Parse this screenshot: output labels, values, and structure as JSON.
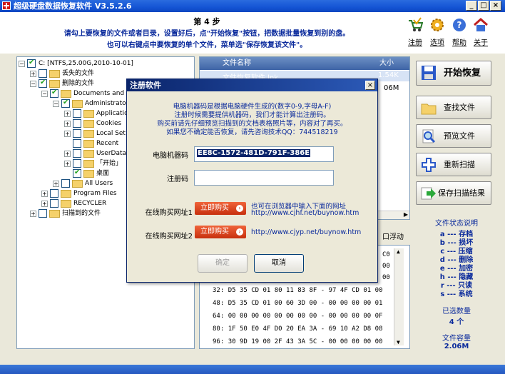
{
  "window": {
    "title": "超级硬盘数据恢复软件 V3.5.2.6",
    "min": "_",
    "max": "□",
    "close": "×"
  },
  "header": {
    "step": "第 4 步",
    "line1": "请勾上要恢复的文件或者目录，设置好后，点\"开始恢复\"按钮，把数据批量恢复到别的盘。",
    "line2": "也可以右键点中要恢复的单个文件，菜单选\"保存恢复该文件\"。"
  },
  "top_links": [
    {
      "label": "注册",
      "icon": "cart-icon"
    },
    {
      "label": "选项",
      "icon": "gear-icon"
    },
    {
      "label": "帮助",
      "icon": "help-icon"
    },
    {
      "label": "关于",
      "icon": "home-icon"
    }
  ],
  "tree": [
    {
      "text": "C: [NTFS,25.00G,2010-10-01]",
      "expander": "−",
      "checked": true
    },
    {
      "text": "丢失的文件",
      "expander": "+",
      "checked": false
    },
    {
      "text": "删除的文件",
      "expander": "−",
      "checked": true
    },
    {
      "text": "Documents and S",
      "expander": "−",
      "checked": true
    },
    {
      "text": "Administrator",
      "expander": "−",
      "checked": true
    },
    {
      "text": "Applicatio",
      "expander": "+",
      "checked": false
    },
    {
      "text": "Cookies",
      "expander": "+",
      "checked": false
    },
    {
      "text": "Local Set",
      "expander": "+",
      "checked": false
    },
    {
      "text": "Recent",
      "expander": "",
      "checked": false
    },
    {
      "text": "UserData",
      "expander": "+",
      "checked": false
    },
    {
      "text": "「开始」",
      "expander": "+",
      "checked": false
    },
    {
      "text": "桌面",
      "expander": "",
      "checked": true
    },
    {
      "text": "All Users",
      "expander": "+",
      "checked": false
    },
    {
      "text": "Program Files",
      "expander": "+",
      "checked": false
    },
    {
      "text": "RECYCLER",
      "expander": "+",
      "checked": false
    },
    {
      "text": "扫描到的文件",
      "expander": "+",
      "checked": false
    }
  ],
  "file_list": {
    "col_name": "文件名称",
    "col_size": "大小",
    "rows": [
      {
        "name": "文件恢复软件.lnk",
        "size": "1.54K"
      }
    ],
    "size2": "06M",
    "float_label": "口浮动"
  },
  "hex": {
    "rows": [
      {
        "off": "32:",
        "bytes": "D5 35 CD 01 80 11 83 8F - 97 4F CD 01 00"
      },
      {
        "off": "48:",
        "bytes": "D5 35 CD 01 00 60 3D 00 - 00 00 00 00 01"
      },
      {
        "off": "64:",
        "bytes": "00 00 00 00 00 00 00 00 - 00 00 00 00 0F"
      },
      {
        "off": "80:",
        "bytes": "1F 50 E0 4F D0 20 EA 3A - 69 10 A2 D8 08"
      },
      {
        "off": "96:",
        "bytes": "30 9D 19 00 2F 43 3A 5C - 00 00 00 00 00"
      }
    ],
    "side": [
      "C0",
      "00",
      "00"
    ]
  },
  "actions": [
    {
      "label": "开始恢复",
      "icon": "save-disk-icon"
    },
    {
      "label": "查找文件",
      "icon": "folder-icon"
    },
    {
      "label": "预览文件",
      "icon": "magnifier-icon"
    },
    {
      "label": "重新扫描",
      "icon": "plus-icon"
    },
    {
      "label": "保存扫描结果",
      "icon": "arrow-right-icon"
    }
  ],
  "legend": {
    "title": "文件状态说明",
    "items": [
      "a --- 存档",
      "b --- 损坏",
      "c --- 压缩",
      "d --- 删除",
      "e --- 加密",
      "h --- 隐藏",
      "r --- 只读",
      "s --- 系统"
    ],
    "count_label": "已选数量",
    "count_value": "4 个",
    "size_label": "文件容量",
    "size_value": "2.06M"
  },
  "dialog": {
    "title": "注册软件",
    "close": "×",
    "info": [
      "电脑机器码是根据电脑硬件生成的(数字0-9,字母A-F)",
      "注册时候需要提供机器码，我们才能计算出注册码。",
      "购买前请先仔细预览扫描到的文档表格照片等，内容对了再买。",
      "如果您不确定能否恢复，请先咨询技术QQ：744518219"
    ],
    "machine_code_label": "电脑机器码",
    "machine_code_value": "EE8C-1572-481D-791F-386E",
    "reg_code_label": "注册码",
    "reg_code_value": "",
    "buy1_label": "在线购买网址1",
    "buy2_label": "在线购买网址2",
    "buy_button": "立即购买",
    "buy1_note": "也可在浏览器中输入下面的网址",
    "buy1_url": "http://www.cjhf.net/buynow.htm",
    "buy2_url": "http://www.cjyp.net/buynow.htm",
    "ok": "确定",
    "cancel": "取消"
  }
}
